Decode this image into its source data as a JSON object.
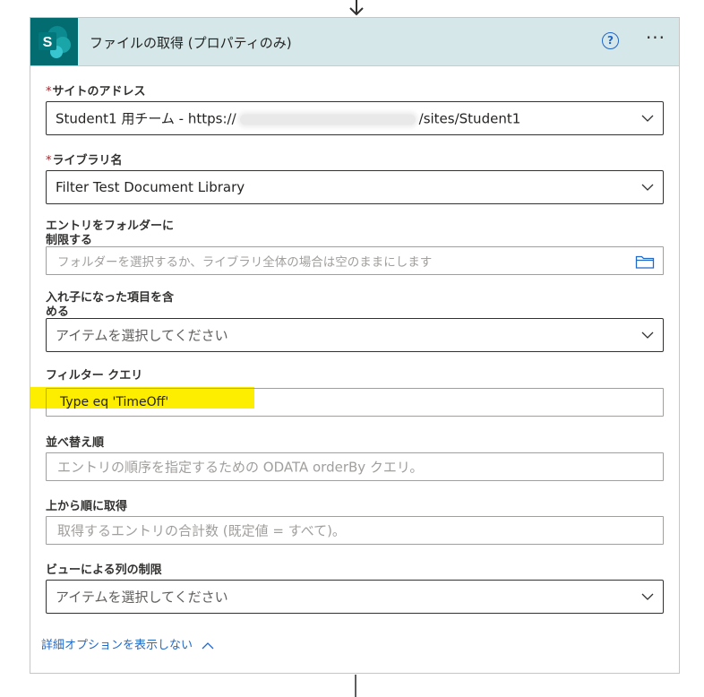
{
  "card": {
    "title": "ファイルの取得 (プロパティのみ)",
    "logo_letter": "S",
    "help_symbol": "?",
    "more_symbol": "···"
  },
  "fields": {
    "site": {
      "required_mark": "*",
      "label": "サイトのアドレス",
      "value_prefix": "Student1 用チーム - https://",
      "value_suffix": "/sites/Student1"
    },
    "library": {
      "required_mark": "*",
      "label": "ライブラリ名",
      "value": "Filter Test Document Library"
    },
    "folder": {
      "label": "エントリをフォルダーに制限する",
      "placeholder": "フォルダーを選択するか、ライブラリ全体の場合は空のままにします"
    },
    "nested": {
      "label": "入れ子になった項目を含める",
      "placeholder": "アイテムを選択してください"
    },
    "filter": {
      "label": "フィルター クエリ",
      "value": "Type eq 'TimeOff'"
    },
    "order": {
      "label": "並べ替え順",
      "placeholder": "エントリの順序を指定するための ODATA orderBy クエリ。"
    },
    "top": {
      "label": "上から順に取得",
      "placeholder": "取得するエントリの合計数 (既定値 = すべて)。"
    },
    "view": {
      "label": "ビューによる列の制限",
      "placeholder": "アイテムを選択してください"
    }
  },
  "advanced_link": "詳細オプションを表示しない",
  "colors": {
    "header_bg": "#d5e7e8",
    "sharepoint_teal": "#036c70",
    "link_blue": "#2169c7",
    "required_red": "#a4262c",
    "highlight_yellow": "#fdee00"
  },
  "icons": {
    "connector": "arrow-down-icon",
    "logo": "sharepoint-logo",
    "help": "help-circle-icon",
    "more": "more-dots-icon",
    "dropdown": "chevron-down-icon",
    "folder": "folder-icon",
    "collapse": "chevron-up-icon"
  }
}
